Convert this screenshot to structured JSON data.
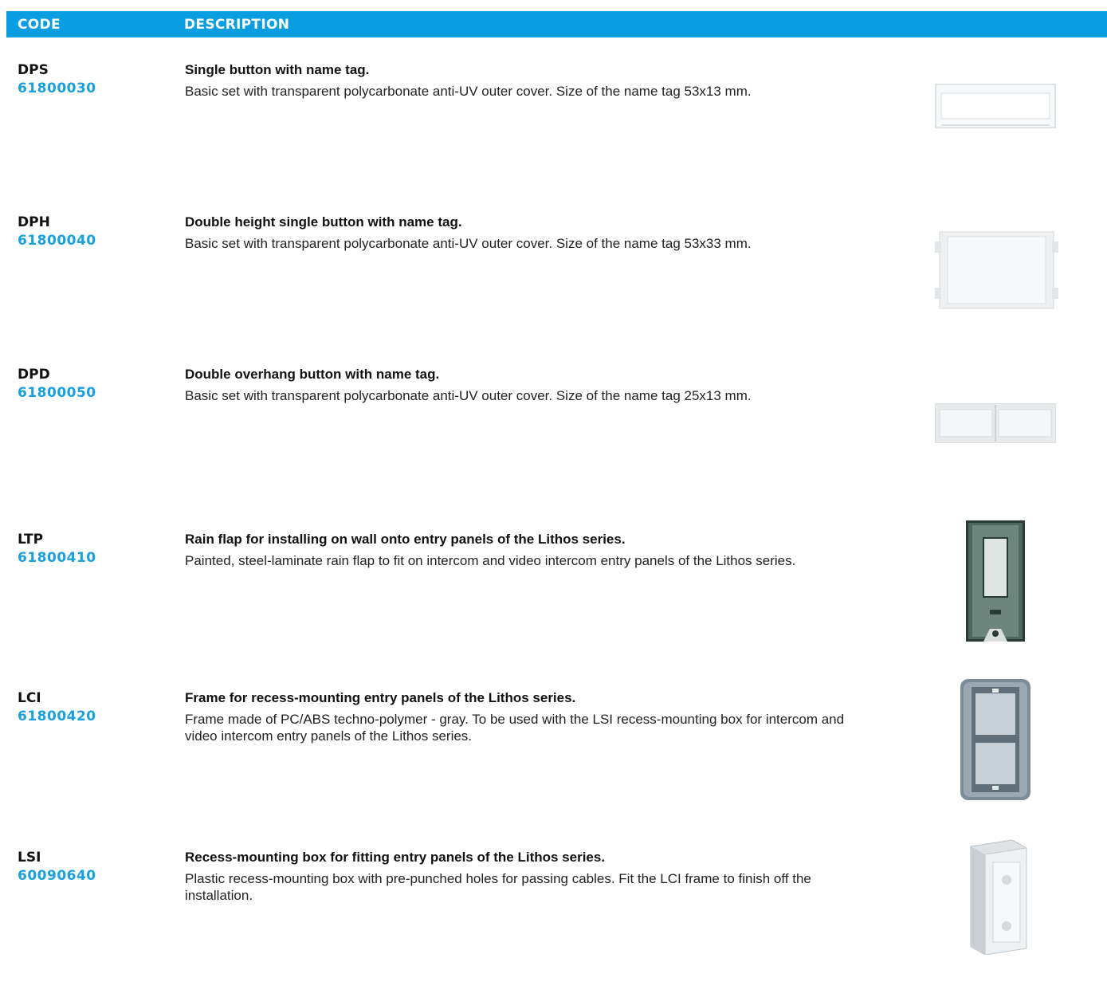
{
  "header": {
    "code_label": "CODE",
    "description_label": "DESCRIPTION"
  },
  "items": [
    {
      "code": "DPS",
      "number": "61800030",
      "title": "Single button with name tag.",
      "text": "Basic set with transparent polycarbonate anti-UV outer cover. Size of the name tag 53x13 mm.",
      "icon": "single-button-nametag-icon"
    },
    {
      "code": "DPH",
      "number": "61800040",
      "title": "Double height single button with name tag.",
      "text": "Basic set with transparent polycarbonate anti-UV outer cover. Size of the name tag 53x33 mm.",
      "icon": "double-height-button-icon"
    },
    {
      "code": "DPD",
      "number": "61800050",
      "title": "Double overhang button with name tag.",
      "text": "Basic set with transparent polycarbonate anti-UV outer cover. Size of the name tag 25x13 mm.",
      "icon": "double-overhang-button-icon"
    },
    {
      "code": "LTP",
      "number": "61800410",
      "title": "Rain flap for installing on wall onto entry panels of the Lithos series.",
      "text": "Painted, steel-laminate rain flap to fit on intercom and video intercom entry panels of the Lithos series.",
      "icon": "rain-flap-icon"
    },
    {
      "code": "LCI",
      "number": "61800420",
      "title": "Frame for recess-mounting entry panels of the Lithos series.",
      "text": "Frame made of PC/ABS techno-polymer - gray. To be used with the LSI recess-mounting box for intercom and video intercom entry panels of the Lithos series.",
      "icon": "recess-frame-icon"
    },
    {
      "code": "LSI",
      "number": "60090640",
      "title": "Recess-mounting box for fitting entry panels of the Lithos series.",
      "text": "Plastic recess-mounting box with pre-punched holes for passing cables. Fit the LCI frame to finish off the installation.",
      "icon": "recess-box-icon"
    }
  ]
}
